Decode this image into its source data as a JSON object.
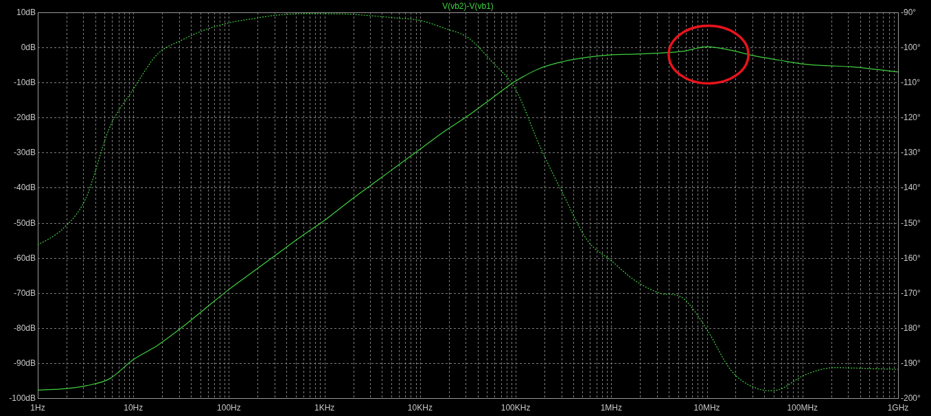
{
  "plot": {
    "chart_data": {
      "type": "line",
      "title": "V(vb2)-V(vb1)",
      "categories": [
        "1Hz",
        null,
        null,
        null,
        "10Hz",
        null,
        null,
        null,
        "100Hz",
        null,
        null,
        null,
        "1KHz",
        null,
        null,
        null,
        "10KHz",
        null,
        null,
        null,
        "100KHz",
        null,
        null,
        null,
        "1MHz",
        null,
        null,
        null,
        "10MHz",
        null,
        null,
        null,
        "100MHz",
        null,
        null,
        null,
        "1GHz"
      ],
      "series": [
        {
          "color": "#3fd23f",
          "values": [
            -97.7,
            -97.4,
            -96.5,
            -94.5,
            -89,
            -85,
            -80,
            -74.5,
            -69,
            -64,
            -59,
            -54,
            -49.3,
            -44,
            -39,
            -34,
            -29,
            -24,
            -19.5,
            -14.5,
            -9.6,
            -6,
            -4,
            -2.8,
            -2.1,
            -1.9,
            -1.6,
            -1.1,
            0.2,
            -0.8,
            -2.4,
            -3.6,
            -4.7,
            -5.2,
            -5.5,
            -6.2,
            -7
          ]
        },
        {
          "axis": "y2",
          "line_style": "dashed",
          "color": "#3fd23f",
          "values": [
            -156.3,
            -152,
            -143.2,
            -123,
            -111.9,
            -102,
            -98,
            -95,
            -93,
            -91.8,
            -90.8,
            -90.4,
            -90.4,
            -90.5,
            -91,
            -91.6,
            -92.3,
            -94.5,
            -97.2,
            -104,
            -112,
            -128,
            -142,
            -155,
            -160.8,
            -166.5,
            -170,
            -171.5,
            -180.4,
            -192,
            -197,
            -197.6,
            -193.7,
            -191.5,
            -191.4,
            -191.6,
            -191.8
          ]
        }
      ],
      "grid": true,
      "ylim": [
        -100,
        10
      ],
      "y2lim": [
        -200,
        -90
      ],
      "yticks": [
        {
          "value": 10,
          "label": "10dB"
        },
        {
          "value": 0,
          "label": "0dB"
        },
        {
          "value": -10,
          "label": "-10dB"
        },
        {
          "value": -20,
          "label": "-20dB"
        },
        {
          "value": -30,
          "label": "-30dB"
        },
        {
          "value": -40,
          "label": "-40dB"
        },
        {
          "value": -50,
          "label": "-50dB"
        },
        {
          "value": -60,
          "label": "-60dB"
        },
        {
          "value": -70,
          "label": "-70dB"
        },
        {
          "value": -80,
          "label": "-80dB"
        },
        {
          "value": -90,
          "label": "-90dB"
        },
        {
          "value": -100,
          "label": "-100dB"
        }
      ],
      "y2ticks": [
        {
          "value": -90,
          "label": "-90°"
        },
        {
          "value": -100,
          "label": "-100°"
        },
        {
          "value": -110,
          "label": "-110°"
        },
        {
          "value": -120,
          "label": "-120°"
        },
        {
          "value": -130,
          "label": "-130°"
        },
        {
          "value": -140,
          "label": "-140°"
        },
        {
          "value": -150,
          "label": "-150°"
        },
        {
          "value": -160,
          "label": "-160°"
        },
        {
          "value": -170,
          "label": "-170°"
        },
        {
          "value": -180,
          "label": "-180°"
        },
        {
          "value": -190,
          "label": "-190°"
        },
        {
          "value": -200,
          "label": "-200°"
        }
      ]
    }
  }
}
